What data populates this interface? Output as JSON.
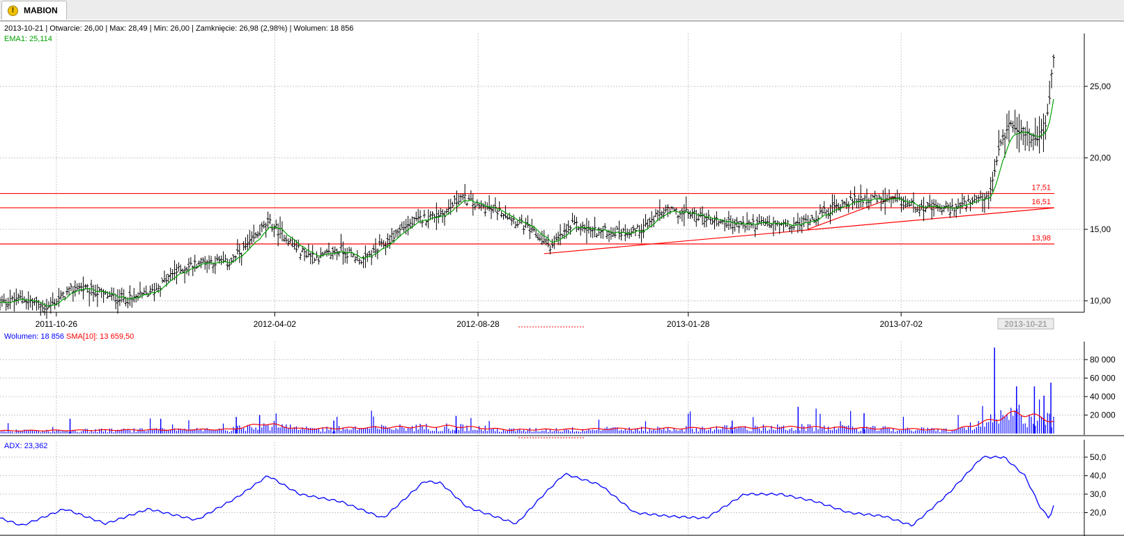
{
  "tab": {
    "title": "MABION",
    "icon": "warning-icon"
  },
  "header": {
    "date": "2013-10-21",
    "open": "26,00",
    "max": "28,49",
    "min": "26,00",
    "close": "26,98 (2,98%)",
    "volume": "18 856",
    "line": "2013-10-21 | Otwarcie: 26,00 | Max: 28,49 | Min: 26,00 | Zamknięcie: 26,98 (2,98%)  | Wolumen: 18 856"
  },
  "chart_data": [
    {
      "type": "line",
      "subtype": "ohlc",
      "name": "MABION",
      "indicator_label": "EMA1: 25,114",
      "x_range": [
        "2011-09-15",
        "2013-10-21"
      ],
      "x_ticks": [
        "2011-10-26",
        "2012-04-02",
        "2012-08-28",
        "2013-01-28",
        "2013-07-02"
      ],
      "current_x_label": "2013-10-21",
      "y_ticks": [
        "10,00",
        "15,00",
        "20,00",
        "25,00"
      ],
      "ylim": [
        9.3,
        28.6
      ],
      "close_path": [
        [
          "2011-09-15",
          9.8
        ],
        [
          "2011-10-01",
          10.2
        ],
        [
          "2011-10-20",
          9.5
        ],
        [
          "2011-10-26",
          10.0
        ],
        [
          "2011-11-10",
          11.0
        ],
        [
          "2011-12-05",
          10.3
        ],
        [
          "2011-12-20",
          10.1
        ],
        [
          "2012-01-05",
          10.7
        ],
        [
          "2012-01-20",
          12.0
        ],
        [
          "2012-02-10",
          12.8
        ],
        [
          "2012-02-28",
          12.6
        ],
        [
          "2012-03-15",
          14.0
        ],
        [
          "2012-03-28",
          15.5
        ],
        [
          "2012-04-05",
          14.9
        ],
        [
          "2012-04-20",
          13.5
        ],
        [
          "2012-05-05",
          13.0
        ],
        [
          "2012-05-20",
          13.6
        ],
        [
          "2012-06-05",
          12.8
        ],
        [
          "2012-06-20",
          13.9
        ],
        [
          "2012-07-05",
          15.2
        ],
        [
          "2012-07-20",
          15.8
        ],
        [
          "2012-08-05",
          16.2
        ],
        [
          "2012-08-15",
          17.3
        ],
        [
          "2012-08-28",
          16.6
        ],
        [
          "2012-09-15",
          16.2
        ],
        [
          "2012-10-05",
          14.9
        ],
        [
          "2012-10-20",
          13.8
        ],
        [
          "2012-11-05",
          15.3
        ],
        [
          "2012-11-20",
          14.9
        ],
        [
          "2012-12-10",
          14.8
        ],
        [
          "2012-12-25",
          15.0
        ],
        [
          "2013-01-10",
          16.3
        ],
        [
          "2013-01-28",
          16.1
        ],
        [
          "2013-02-15",
          15.7
        ],
        [
          "2013-03-05",
          15.3
        ],
        [
          "2013-03-25",
          15.4
        ],
        [
          "2013-04-15",
          15.2
        ],
        [
          "2013-05-05",
          16.1
        ],
        [
          "2013-05-20",
          16.8
        ],
        [
          "2013-06-05",
          17.2
        ],
        [
          "2013-06-20",
          17.0
        ],
        [
          "2013-07-02",
          16.9
        ],
        [
          "2013-07-20",
          16.5
        ],
        [
          "2013-08-05",
          16.4
        ],
        [
          "2013-08-20",
          16.8
        ],
        [
          "2013-08-30",
          17.0
        ],
        [
          "2013-09-05",
          17.5
        ],
        [
          "2013-09-12",
          21.0
        ],
        [
          "2013-09-20",
          22.5
        ],
        [
          "2013-09-30",
          21.7
        ],
        [
          "2013-10-10",
          21.3
        ],
        [
          "2013-10-16",
          22.4
        ],
        [
          "2013-10-21",
          26.98
        ]
      ],
      "h_levels": [
        {
          "value": 17.51,
          "label": "17,51"
        },
        {
          "value": 16.51,
          "label": "16,51"
        },
        {
          "value": 13.98,
          "label": "13,98"
        }
      ],
      "trend_lines": [
        {
          "from": [
            "2012-10-15",
            13.3
          ],
          "to": [
            "2013-10-21",
            16.5
          ]
        },
        {
          "from": [
            "2013-04-25",
            15.0
          ],
          "to": [
            "2013-06-28",
            17.3
          ]
        }
      ],
      "colors": {
        "bars": "#000000",
        "ema": "#00a000",
        "levels": "#ff0000",
        "grid": "#c8c8c8"
      }
    },
    {
      "type": "bar",
      "name": "Wolumen",
      "legend": [
        {
          "label": "Wolumen: 18 856",
          "color": "#0000ff"
        },
        {
          "label": "SMA[10]: 13 659,50",
          "color": "#ff0000"
        }
      ],
      "y_ticks": [
        "20 000",
        "40 000",
        "60 000",
        "80 000"
      ],
      "ylim": [
        0,
        95000
      ],
      "spikes": [
        [
          "2011-11-05",
          16000
        ],
        [
          "2012-01-10",
          16000
        ],
        [
          "2012-03-05",
          18000
        ],
        [
          "2012-03-22",
          20000
        ],
        [
          "2012-05-15",
          14000
        ],
        [
          "2012-08-12",
          19000
        ],
        [
          "2013-03-01",
          14000
        ],
        [
          "2013-04-18",
          29000
        ],
        [
          "2013-06-05",
          22000
        ],
        [
          "2013-09-08",
          93000
        ],
        [
          "2013-09-24",
          51000
        ],
        [
          "2013-10-07",
          51000
        ],
        [
          "2013-10-14",
          41000
        ],
        [
          "2013-10-19",
          55000
        ]
      ],
      "sma_path": [
        [
          "2011-09-15",
          3000
        ],
        [
          "2012-03-01",
          4500
        ],
        [
          "2012-03-25",
          11000
        ],
        [
          "2012-04-20",
          5000
        ],
        [
          "2012-08-10",
          8000
        ],
        [
          "2012-09-20",
          4000
        ],
        [
          "2013-04-20",
          7000
        ],
        [
          "2013-08-10",
          4000
        ],
        [
          "2013-09-10",
          16000
        ],
        [
          "2013-09-25",
          23000
        ],
        [
          "2013-10-21",
          13660
        ]
      ]
    },
    {
      "type": "line",
      "name": "ADX",
      "legend": [
        {
          "label": "ADX: 23,362",
          "color": "#0000ff"
        }
      ],
      "y_ticks": [
        "20,0",
        "30,0",
        "40,0",
        "50,0"
      ],
      "ylim": [
        10,
        56
      ],
      "path": [
        [
          "2011-09-15",
          17
        ],
        [
          "2011-10-01",
          13
        ],
        [
          "2011-11-01",
          22
        ],
        [
          "2011-12-01",
          14
        ],
        [
          "2012-01-01",
          22
        ],
        [
          "2012-02-05",
          16
        ],
        [
          "2012-03-05",
          28
        ],
        [
          "2012-03-28",
          40
        ],
        [
          "2012-04-20",
          30
        ],
        [
          "2012-05-20",
          26
        ],
        [
          "2012-06-20",
          17
        ],
        [
          "2012-07-20",
          37
        ],
        [
          "2012-08-01",
          36
        ],
        [
          "2012-08-20",
          23
        ],
        [
          "2012-09-25",
          14
        ],
        [
          "2012-10-15",
          30
        ],
        [
          "2012-10-30",
          41
        ],
        [
          "2012-11-25",
          35
        ],
        [
          "2012-12-20",
          20
        ],
        [
          "2013-01-15",
          18
        ],
        [
          "2013-02-10",
          17
        ],
        [
          "2013-03-10",
          30
        ],
        [
          "2013-04-05",
          30
        ],
        [
          "2013-05-01",
          26
        ],
        [
          "2013-05-25",
          20
        ],
        [
          "2013-06-20",
          18
        ],
        [
          "2013-07-10",
          13
        ],
        [
          "2013-08-05",
          30
        ],
        [
          "2013-08-30",
          50
        ],
        [
          "2013-09-15",
          50
        ],
        [
          "2013-09-30",
          40
        ],
        [
          "2013-10-12",
          22
        ],
        [
          "2013-10-18",
          17
        ],
        [
          "2013-10-21",
          23.36
        ]
      ]
    }
  ]
}
